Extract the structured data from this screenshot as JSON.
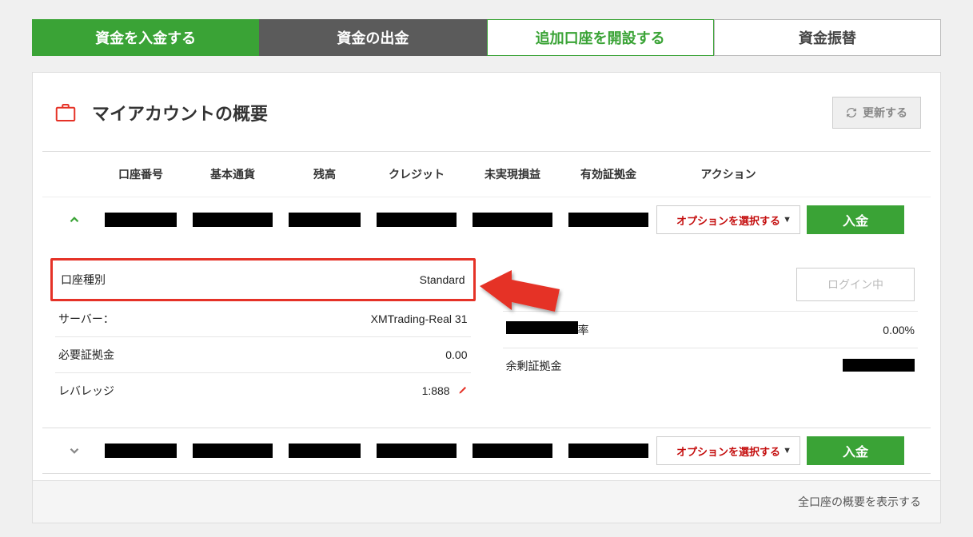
{
  "tabs": {
    "deposit": "資金を入金する",
    "withdraw": "資金の出金",
    "newAccount": "追加口座を開設する",
    "transfer": "資金振替"
  },
  "panel": {
    "title": "マイアカウントの概要",
    "refresh": "更新する"
  },
  "tableHead": {
    "accountNo": "口座番号",
    "baseCcy": "基本通貨",
    "balance": "残高",
    "credit": "クレジット",
    "unrealized": "未実現損益",
    "equity": "有効証拠金",
    "action": "アクション"
  },
  "row": {
    "optionLabel": "オプションを選択する",
    "depositBtn": "入金"
  },
  "details": {
    "acctTypeLabel": "口座種別",
    "acctTypeValue": "Standard",
    "serverLabel": "サーバー：",
    "serverValue": "XMTrading-Real 31",
    "marginReqLabel": "必要証拠金",
    "marginReqValue": "0.00",
    "leverageLabel": "レバレッジ",
    "leverageValue": "1:888",
    "loginBadge": "ログイン中",
    "rateLabelSuffix": "率",
    "rateValue": "0.00%",
    "freeMarginLabel": "余剰証拠金"
  },
  "footer": {
    "showAll": "全口座の概要を表示する"
  }
}
